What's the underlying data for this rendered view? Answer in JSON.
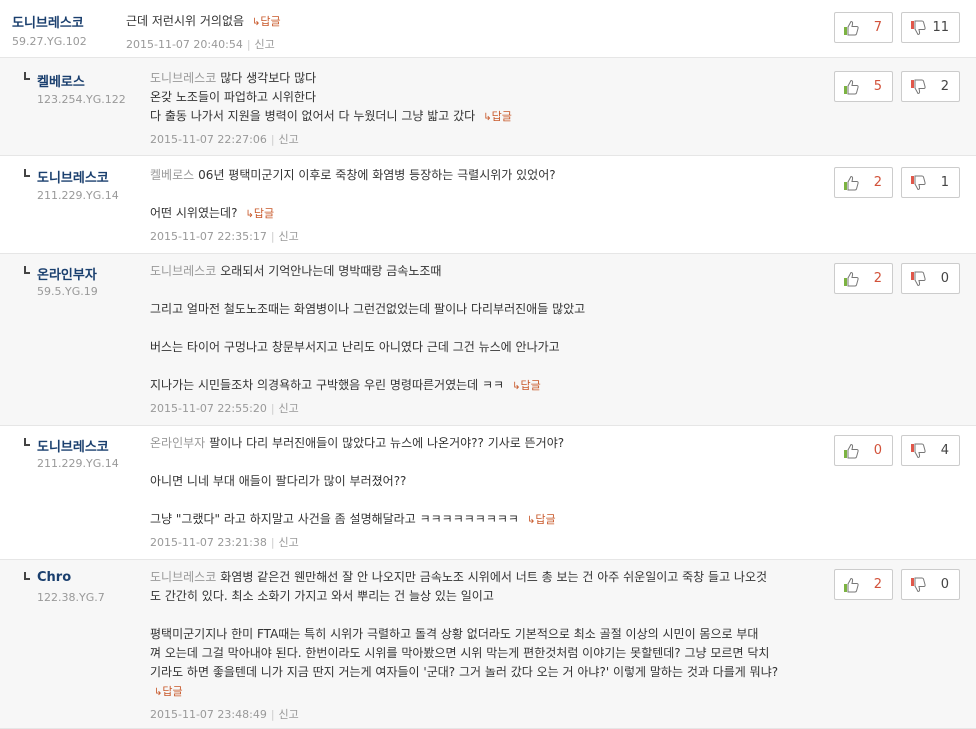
{
  "comments": [
    {
      "author": "도니브레스코",
      "ip": "59.27.YG.102",
      "lines": [
        {
          "text": "근데 저런시위 거의없음",
          "reply": true
        }
      ],
      "timestamp": "2015-11-07 20:40:54",
      "report": "신고",
      "reply_label": "답글",
      "up": "7",
      "down": "11"
    },
    {
      "author": "켈베로스",
      "ip": "123.254.YG.122",
      "mention": "도니브레스코",
      "lines": [
        {
          "text": "많다 생각보다 많다"
        },
        {
          "text": "온갖 노조들이 파업하고 시위한다"
        },
        {
          "text": "다 출동 나가서 지원을 병력이 없어서 다 누웠더니 그냥 밟고 갔다",
          "reply": true
        }
      ],
      "timestamp": "2015-11-07 22:27:06",
      "report": "신고",
      "reply_label": "답글",
      "up": "5",
      "down": "2"
    },
    {
      "author": "도니브레스코",
      "ip": "211.229.YG.14",
      "mention": "켈베로스",
      "lines": [
        {
          "text": "06년 평택미군기지 이후로 죽창에 화염병 등장하는 극렬시위가 있었어?"
        },
        {
          "text": ""
        },
        {
          "text": "어떤 시위였는데?",
          "reply": true
        }
      ],
      "timestamp": "2015-11-07 22:35:17",
      "report": "신고",
      "reply_label": "답글",
      "up": "2",
      "down": "1"
    },
    {
      "author": "온라인부자",
      "ip": "59.5.YG.19",
      "mention": "도니브레스코",
      "lines": [
        {
          "text": "오래되서 기억안나는데 명박때랑 금속노조때"
        },
        {
          "text": ""
        },
        {
          "text": "그리고 얼마전 철도노조때는 화염병이나 그런건없었는데 팔이나 다리부러진애들 많았고"
        },
        {
          "text": ""
        },
        {
          "text": "버스는 타이어 구멍나고 창문부서지고 난리도 아니였다 근데 그건 뉴스에 안나가고"
        },
        {
          "text": ""
        },
        {
          "text": "지나가는 시민들조차 의경욕하고 구박했음 우린 명령따른거였는데 ㅋㅋ",
          "reply": true
        }
      ],
      "timestamp": "2015-11-07 22:55:20",
      "report": "신고",
      "reply_label": "답글",
      "up": "2",
      "down": "0"
    },
    {
      "author": "도니브레스코",
      "ip": "211.229.YG.14",
      "mention": "온라인부자",
      "lines": [
        {
          "text": "팔이나 다리 부러진애들이 많았다고 뉴스에 나온거야?? 기사로 뜬거야?"
        },
        {
          "text": ""
        },
        {
          "text": "아니면 니네 부대 애들이 팔다리가 많이 부러졌어??"
        },
        {
          "text": ""
        },
        {
          "text": "그냥 \"그랬다\" 라고 하지말고 사건을 좀 설명해달라고 ㅋㅋㅋㅋㅋㅋㅋㅋㅋ",
          "reply": true
        }
      ],
      "timestamp": "2015-11-07 23:21:38",
      "report": "신고",
      "reply_label": "답글",
      "up": "0",
      "down": "4"
    },
    {
      "author": "Chro",
      "ip": "122.38.YG.7",
      "mention": "도니브레스코",
      "lines": [
        {
          "text": "화염병 같은건 웬만해선 잘 안 나오지만 금속노조 시위에서 너트 총 보는 건 아주 쉬운일이고 죽창 들고 나오것"
        },
        {
          "text": "도 간간히 있다. 최소 소화기 가지고 와서 뿌리는 건 늘상 있는 일이고"
        },
        {
          "text": ""
        },
        {
          "text": "평택미군기지나 한미 FTA때는 특히 시위가 극렬하고 돌격 상황 없더라도 기본적으로 최소 골절 이상의 시민이 몸으로 부대"
        },
        {
          "text": "껴 오는데 그걸 막아내야 된다. 한번이라도 시위를 막아봤으면 시위 막는게 편한것처럼 이야기는 못할텐데? 그냥 모르면 닥치"
        },
        {
          "text": "기라도 하면 좋을텐데 니가 지금 딴지 거는게 여자들이 '군대? 그거 놀러 갔다 오는 거 아냐?' 이렇게 말하는 것과 다를게 뭐냐?"
        },
        {
          "text": "",
          "reply": true
        }
      ],
      "timestamp": "2015-11-07 23:48:49",
      "report": "신고",
      "reply_label": "답글",
      "up": "2",
      "down": "0"
    }
  ]
}
